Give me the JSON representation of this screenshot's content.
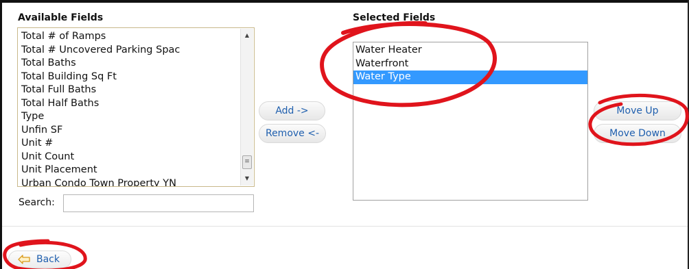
{
  "available": {
    "label": "Available Fields",
    "items": [
      "Total # of Ramps",
      "Total # Uncovered Parking Spac",
      "Total Baths",
      "Total Building Sq Ft",
      "Total Full Baths",
      "Total Half Baths",
      "Type",
      "Unfin SF",
      "Unit #",
      "Unit Count",
      "Unit Placement",
      "Urban Condo Town Property YN"
    ]
  },
  "selected": {
    "label": "Selected Fields",
    "items": [
      "Water Heater",
      "Waterfront",
      "Water Type"
    ],
    "selected_item": "Water Type"
  },
  "search": {
    "label": "Search:",
    "value": ""
  },
  "buttons": {
    "add": "Add ->",
    "remove": "Remove <-",
    "move_up": "Move Up",
    "move_down": "Move Down",
    "back": "Back"
  },
  "colors": {
    "selection": "#3399ff",
    "button_text": "#1f5fae",
    "annotation": "#e0141c"
  },
  "icons": {
    "back": "arrow-left-icon",
    "scroll_up": "chevron-up-icon",
    "scroll_down": "chevron-down-icon",
    "scroll_grip": "grip-icon"
  }
}
